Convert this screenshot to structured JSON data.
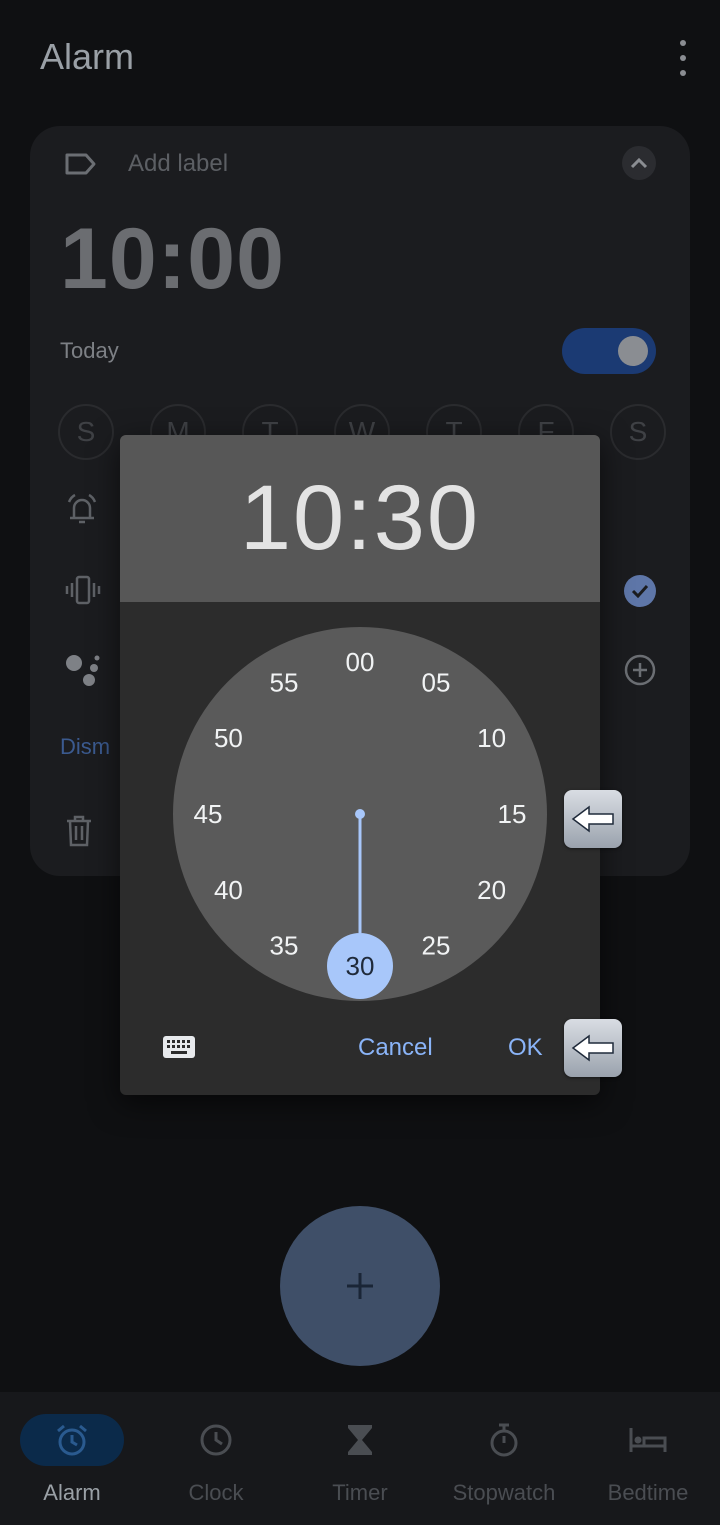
{
  "header": {
    "title": "Alarm"
  },
  "alarm_card": {
    "add_label": "Add label",
    "time": "10:00",
    "schedule": "Today",
    "toggle_on": true,
    "days": [
      "S",
      "M",
      "T",
      "W",
      "T",
      "F",
      "S"
    ],
    "dismiss_partial": "Dism"
  },
  "dialog": {
    "time": "10:30",
    "minutes": [
      "00",
      "05",
      "10",
      "15",
      "20",
      "25",
      "30",
      "35",
      "40",
      "45",
      "50",
      "55"
    ],
    "selected_minute": "30",
    "cancel_label": "Cancel",
    "ok_label": "OK"
  },
  "bottom_nav": {
    "items": [
      {
        "label": "Alarm",
        "icon": "alarm-icon",
        "active": true
      },
      {
        "label": "Clock",
        "icon": "clock-icon",
        "active": false
      },
      {
        "label": "Timer",
        "icon": "hourglass-icon",
        "active": false
      },
      {
        "label": "Stopwatch",
        "icon": "stopwatch-icon",
        "active": false
      },
      {
        "label": "Bedtime",
        "icon": "bed-icon",
        "active": false
      }
    ]
  },
  "colors": {
    "accent": "#8ab4f8",
    "dial_face": "#5a5a5a",
    "dialog_bg": "#2c2c2c",
    "header_bg": "#575757",
    "selected_bg": "#a8c7fa"
  },
  "annotations": {
    "arrow_glyph": "⬅"
  }
}
